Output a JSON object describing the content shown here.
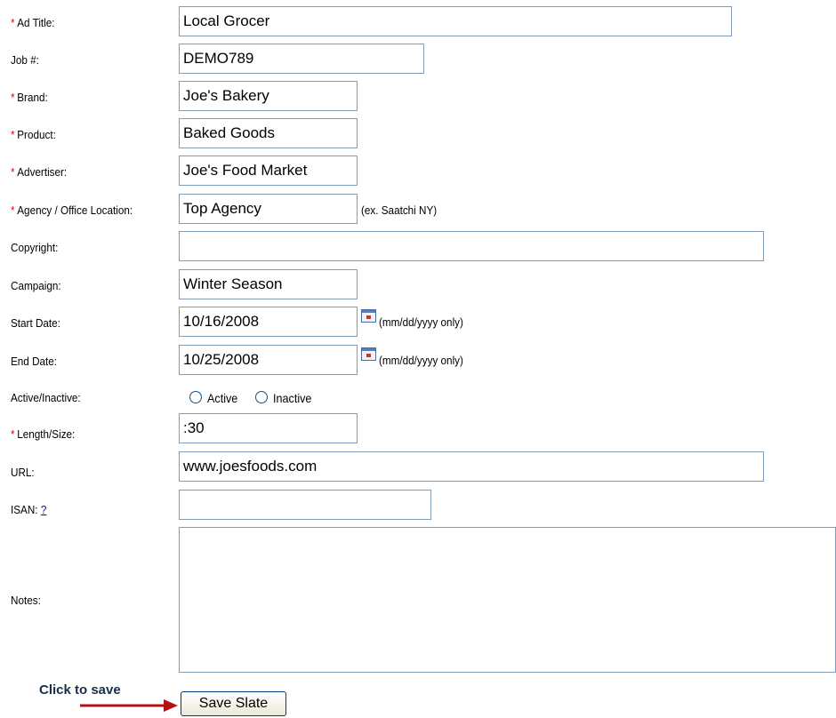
{
  "fields": {
    "ad_title": {
      "label": "Ad Title:",
      "value": "Local Grocer"
    },
    "job": {
      "label": "Job #:",
      "value": "DEMO789"
    },
    "brand": {
      "label": "Brand:",
      "value": "Joe's Bakery"
    },
    "product": {
      "label": "Product:",
      "value": "Baked Goods"
    },
    "advertiser": {
      "label": "Advertiser:",
      "value": "Joe's Food Market"
    },
    "agency": {
      "label": "Agency / Office Location:",
      "value": "Top Agency",
      "hint": "(ex. Saatchi NY)"
    },
    "copyright": {
      "label": "Copyright:",
      "value": ""
    },
    "campaign": {
      "label": "Campaign:",
      "value": "Winter Season"
    },
    "start_date": {
      "label": "Start Date:",
      "value": "10/16/2008",
      "hint": "(mm/dd/yyyy only)"
    },
    "end_date": {
      "label": "End Date:",
      "value": "10/25/2008",
      "hint": "(mm/dd/yyyy only)"
    },
    "active": {
      "label": "Active/Inactive:",
      "option_active": "Active",
      "option_inactive": "Inactive"
    },
    "length": {
      "label": "Length/Size:",
      "value": ":30"
    },
    "url": {
      "label": "URL:",
      "value": "www.joesfoods.com"
    },
    "isan": {
      "label": "ISAN:",
      "help": "?",
      "value": ""
    },
    "notes": {
      "label": "Notes:",
      "value": ""
    }
  },
  "required_marker": "*",
  "save_button": "Save Slate",
  "annotation": "Click to save",
  "colors": {
    "required": "#d40000",
    "field_border": "#7f9db9",
    "arrow": "#b01010"
  }
}
